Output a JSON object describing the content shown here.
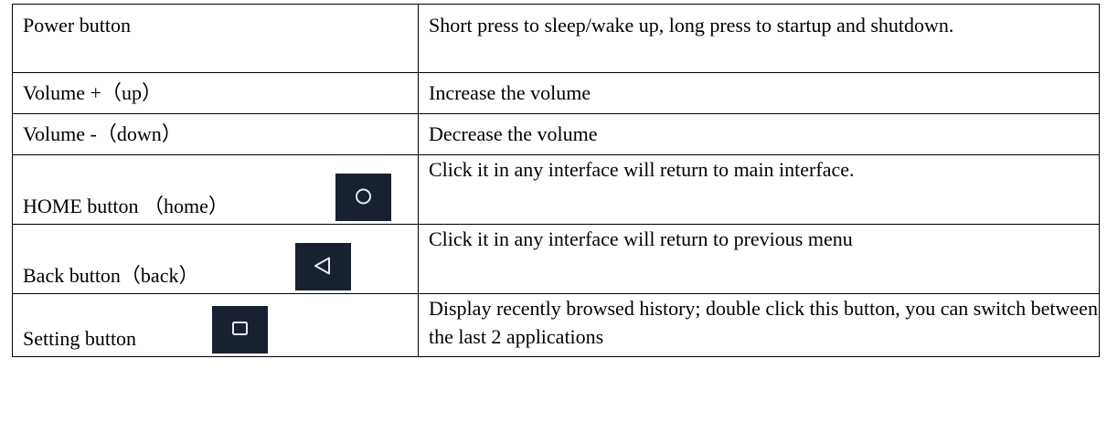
{
  "rows": [
    {
      "name": "Power button",
      "description": "Short press to sleep/wake up, long press to startup and shutdown."
    },
    {
      "name": "Volume +（up）",
      "description": "Increase the volume"
    },
    {
      "name": "Volume -（down）",
      "description": "Decrease the volume"
    },
    {
      "name": "HOME button  （home）",
      "icon": "home-circle-icon",
      "description": "Click it in any interface will return to main interface."
    },
    {
      "name": "Back button（back）",
      "icon": "back-triangle-icon",
      "description": "Click it in any interface will return to previous menu"
    },
    {
      "name": "Setting button",
      "icon": "recent-square-icon",
      "description": "Display recently browsed history; double click this button, you can switch between the last 2 applications"
    }
  ],
  "colors": {
    "icon_background": "#17212f",
    "icon_stroke": "#e6e9ee",
    "border": "#000000"
  }
}
